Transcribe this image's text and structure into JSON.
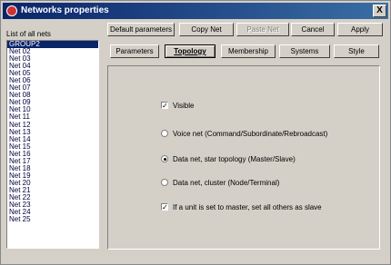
{
  "window": {
    "title": "Networks properties",
    "close_glyph": "X"
  },
  "list": {
    "label": "List of all nets",
    "items": [
      "GROUP2",
      "Net 02",
      "Net 03",
      "Net 04",
      "Net 05",
      "Net 06",
      "Net 07",
      "Net 08",
      "Net 09",
      "Net 10",
      "Net 11",
      "Net 12",
      "Net 13",
      "Net 14",
      "Net 15",
      "Net 16",
      "Net 17",
      "Net 18",
      "Net 19",
      "Net 20",
      "Net 21",
      "Net 22",
      "Net 23",
      "Net 24",
      "Net 25"
    ],
    "selected_index": 0
  },
  "toolbar": {
    "default_params": "Default parameters",
    "copy_net": "Copy Net",
    "paste_net": "Paste Net",
    "cancel": "Cancel",
    "apply": "Apply"
  },
  "tabs": {
    "parameters": "Parameters",
    "topology": "Topology",
    "membership": "Membership",
    "systems": "Systems",
    "style": "Style",
    "active": "topology"
  },
  "options": {
    "visible": {
      "label": "Visible",
      "checked": true
    },
    "voice_net": {
      "label": "Voice net (Command/Subordinate/Rebroadcast)",
      "selected": false
    },
    "data_star": {
      "label": "Data net, star topology (Master/Slave)",
      "selected": true
    },
    "data_cluster": {
      "label": "Data net, cluster (Node/Terminal)",
      "selected": false
    },
    "slave_rule": {
      "label": "If a unit is set to master, set all others as slave",
      "checked": true
    }
  },
  "icons": {
    "app": "app-icon",
    "close": "close-icon",
    "check": "checkmark-icon"
  }
}
